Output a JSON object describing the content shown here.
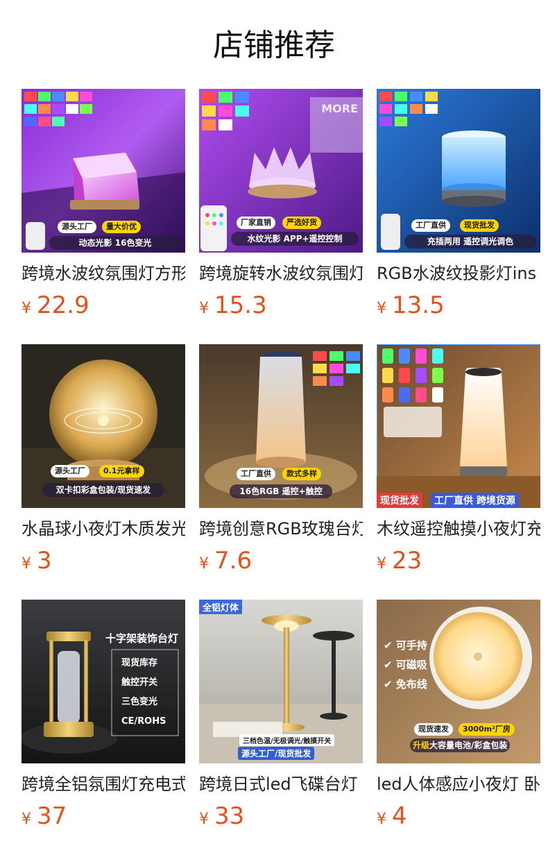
{
  "page": {
    "title": "店铺推荐"
  },
  "currency_symbol": "¥",
  "colors": {
    "price": "#e4521b",
    "badge_yellow": "#ffd400"
  },
  "products": [
    {
      "name": "跨境水波纹氛围灯方形",
      "price": "22.9",
      "image_text": {
        "pill_a": "源头工厂",
        "pill_b": "量大价优",
        "strip": "动态光影  16色变光"
      }
    },
    {
      "name": "跨境旋转水波纹氛围灯",
      "price": "15.3",
      "image_text": {
        "watermark": "MORE",
        "pill_a": "厂家直销",
        "pill_b": "严选好货",
        "strip": "水纹光影  APP+遥控控制"
      }
    },
    {
      "name": "RGB水波纹投影灯ins",
      "price": "13.5",
      "image_text": {
        "pill_a": "工厂直供",
        "pill_b": "现货批发",
        "strip": "充插两用  遥控调光调色"
      }
    },
    {
      "name": "水晶球小夜灯木质发光",
      "price": "3",
      "image_text": {
        "pill_a": "源头工厂",
        "pill_b": "0.1元拿样",
        "strip": "双卡扣彩盒包装/现货速发"
      }
    },
    {
      "name": "跨境创意RGB玫瑰台灯",
      "price": "7.6",
      "image_text": {
        "pill_a": "工厂直供",
        "pill_b": "款式多样",
        "strip": "16色RGB 遥控+触控"
      }
    },
    {
      "name": "木纹遥控触摸小夜灯充电",
      "price": "23",
      "image_text": {
        "tag_a": "现货批发",
        "tag_b": "工厂直供 跨境货源"
      }
    },
    {
      "name": "跨境全铝氛围灯充电式",
      "price": "37",
      "image_text": {
        "heading": "十字架装饰台灯",
        "features": [
          "现货库存",
          "触控开关",
          "三色变光",
          "CE/ROHS"
        ]
      }
    },
    {
      "name": "跨境日式led飞碟台灯",
      "price": "33",
      "image_text": {
        "corner": "全铝灯体",
        "strip_top": "三档色温/无极调光/触摸开关",
        "strip": "源头工厂/现货批发"
      }
    },
    {
      "name": "led人体感应小夜灯 卧室",
      "price": "4",
      "image_text": {
        "checks": [
          "可手持",
          "可磁吸",
          "免布线"
        ],
        "pill_a": "现货速发",
        "pill_b": "3000m²厂房",
        "strip_hl": "升级",
        "strip": "大容量电池/彩盒包装"
      }
    }
  ]
}
